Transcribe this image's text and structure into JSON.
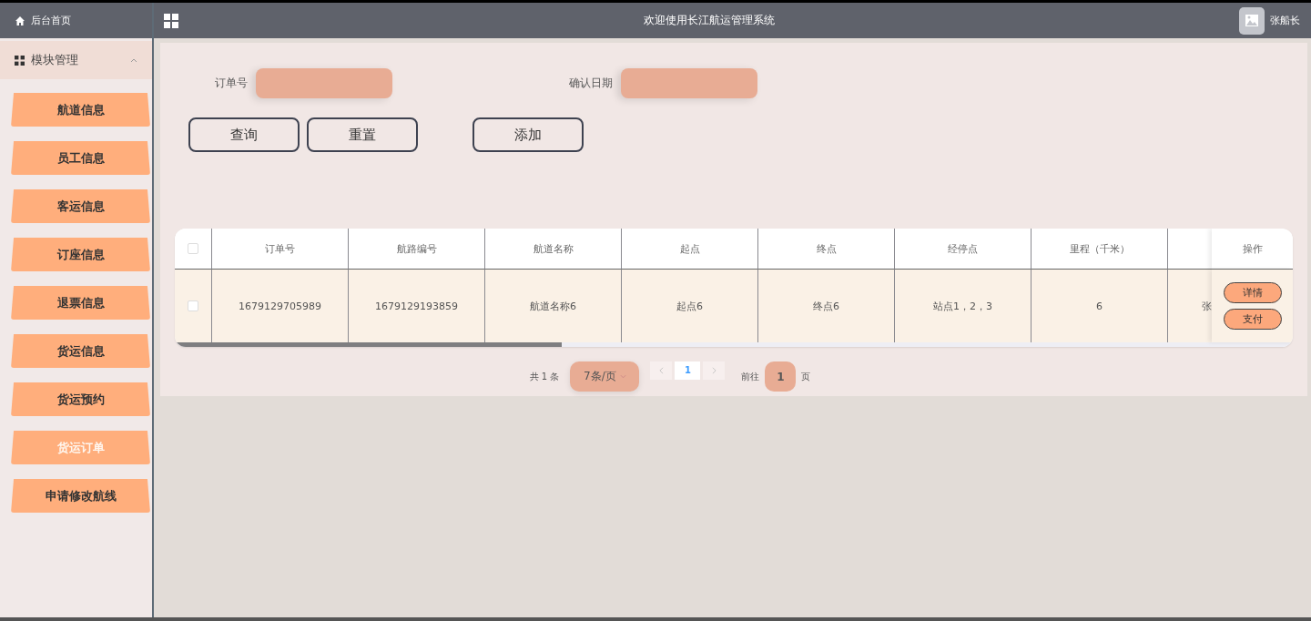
{
  "sidebar": {
    "home": {
      "label": "后台首页"
    },
    "group": {
      "label": "模块管理",
      "expanded": true
    },
    "items": [
      {
        "label": "航道信息",
        "selected": false
      },
      {
        "label": "员工信息",
        "selected": false
      },
      {
        "label": "客运信息",
        "selected": false
      },
      {
        "label": "订座信息",
        "selected": false
      },
      {
        "label": "退票信息",
        "selected": false
      },
      {
        "label": "货运信息",
        "selected": false
      },
      {
        "label": "货运预约",
        "selected": false
      },
      {
        "label": "货运订单",
        "selected": true
      },
      {
        "label": "申请修改航线",
        "selected": false
      }
    ]
  },
  "header": {
    "title": "欢迎使用长江航运管理系统",
    "user": "张船长"
  },
  "search": {
    "fields": [
      {
        "label": "订单号"
      },
      {
        "label": "确认日期"
      }
    ],
    "buttons": [
      "查询",
      "重置"
    ],
    "add_button": "添加"
  },
  "table": {
    "columns": [
      "订单号",
      "航路编号",
      "航道名称",
      "起点",
      "终点",
      "经停点",
      "里程（千米）"
    ],
    "action_column": "操作",
    "header_checked": false,
    "rows": [
      {
        "checked": false,
        "cells": [
          "1679129705989",
          "1679129193859",
          "航道名称6",
          "起点6",
          "终点6",
          "站点1，2，3",
          "6"
        ],
        "column_9": "张",
        "actions": [
          "详情",
          "支付"
        ]
      }
    ]
  },
  "pagination": {
    "total": "共 1 条",
    "page_size": "7条/页",
    "pages": [
      {
        "label": "1",
        "selected": true
      }
    ],
    "goto_label": "前往",
    "goto_value": "1",
    "goto_suffix": "页"
  }
}
